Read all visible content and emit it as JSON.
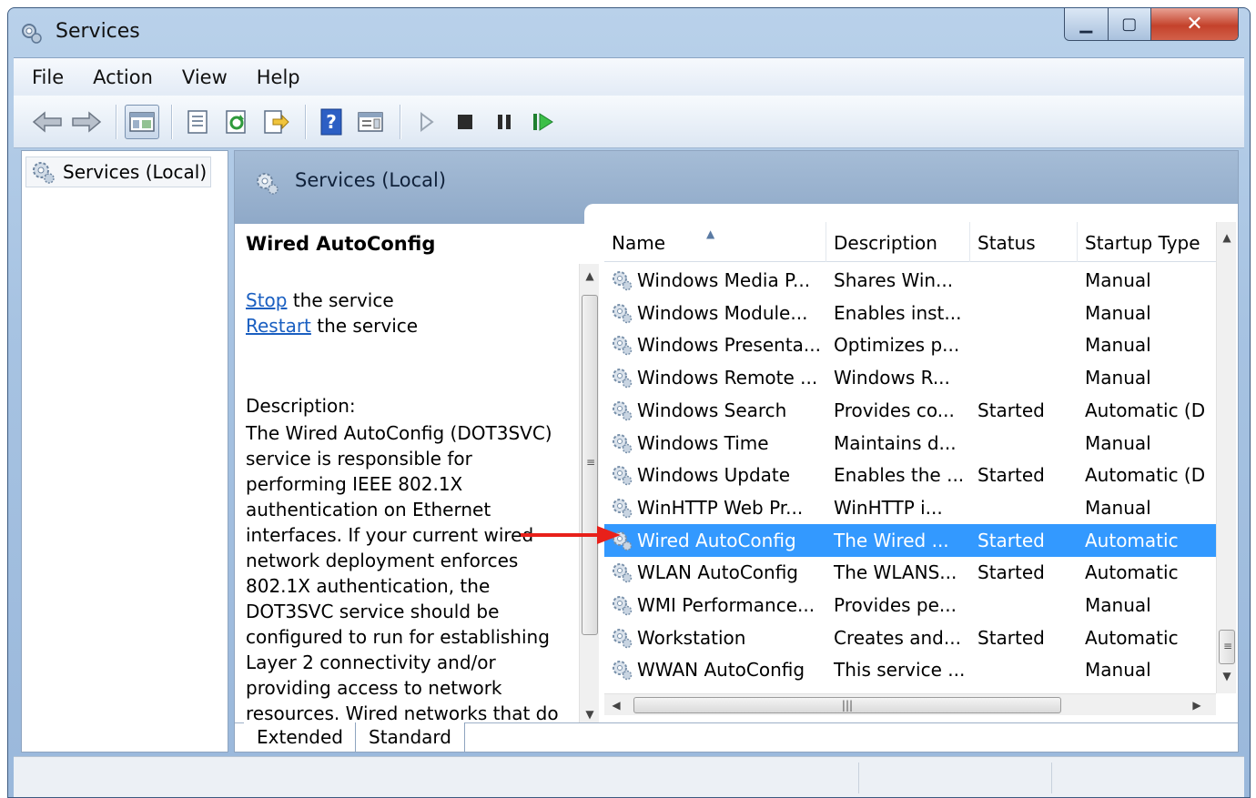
{
  "window": {
    "title": "Services"
  },
  "menu": [
    "File",
    "Action",
    "View",
    "Help"
  ],
  "tree": {
    "root": "Services (Local)"
  },
  "header": {
    "title": "Services (Local)"
  },
  "details": {
    "service_name": "Wired AutoConfig",
    "action1_link": "Stop",
    "action1_rest": " the service",
    "action2_link": "Restart",
    "action2_rest": " the service",
    "description_label": "Description:",
    "description": "The Wired AutoConfig (DOT3SVC) service is responsible for performing IEEE 802.1X authentication on Ethernet interfaces. If your current wired network deployment enforces 802.1X authentication, the DOT3SVC service should be configured to run for establishing Layer 2 connectivity and/or providing access to network resources. Wired networks that do"
  },
  "table": {
    "columns": [
      "Name",
      "Description",
      "Status",
      "Startup Type"
    ],
    "rows": [
      {
        "name": "Windows Media P...",
        "description": "Shares Win...",
        "status": "",
        "startup": "Manual"
      },
      {
        "name": "Windows Module...",
        "description": "Enables inst...",
        "status": "",
        "startup": "Manual"
      },
      {
        "name": "Windows Presenta...",
        "description": "Optimizes p...",
        "status": "",
        "startup": "Manual"
      },
      {
        "name": "Windows Remote ...",
        "description": "Windows R...",
        "status": "",
        "startup": "Manual"
      },
      {
        "name": "Windows Search",
        "description": "Provides co...",
        "status": "Started",
        "startup": "Automatic (D"
      },
      {
        "name": "Windows Time",
        "description": "Maintains d...",
        "status": "",
        "startup": "Manual"
      },
      {
        "name": "Windows Update",
        "description": "Enables the ...",
        "status": "Started",
        "startup": "Automatic (D"
      },
      {
        "name": "WinHTTP Web Pr...",
        "description": "WinHTTP i...",
        "status": "",
        "startup": "Manual"
      },
      {
        "name": "Wired AutoConfig",
        "description": "The Wired ...",
        "status": "Started",
        "startup": "Automatic",
        "selected": true
      },
      {
        "name": "WLAN AutoConfig",
        "description": "The WLANS...",
        "status": "Started",
        "startup": "Automatic"
      },
      {
        "name": "WMI Performance...",
        "description": "Provides pe...",
        "status": "",
        "startup": "Manual"
      },
      {
        "name": "Workstation",
        "description": "Creates and...",
        "status": "Started",
        "startup": "Automatic"
      },
      {
        "name": "WWAN AutoConfig",
        "description": "This service ...",
        "status": "",
        "startup": "Manual"
      }
    ]
  },
  "tabs": [
    "Extended",
    "Standard"
  ],
  "colors": {
    "selection": "#3399ff",
    "link": "#1a5fc1",
    "annotation_arrow": "#e8201a"
  },
  "icons": {
    "back": "arrow-left-icon",
    "forward": "arrow-right-icon",
    "console_tree": "console-tree-icon",
    "properties": "properties-icon",
    "refresh": "refresh-icon",
    "export": "export-list-icon",
    "help": "help-icon",
    "show_pane": "show-action-pane-icon",
    "start": "play-icon",
    "stop": "stop-icon",
    "pause": "pause-icon",
    "restart": "restart-icon",
    "service": "gear-icon"
  }
}
